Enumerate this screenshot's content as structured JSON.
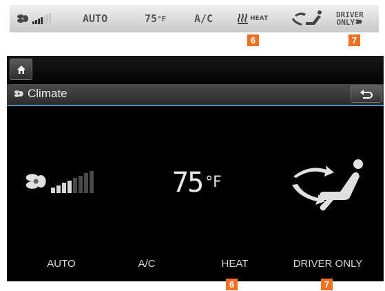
{
  "status_strip": {
    "fan_bars": {
      "level": 4,
      "max": 7
    },
    "auto": "AUTO",
    "temperature": "75",
    "temperature_unit": "°F",
    "ac": "A/C",
    "heat": "HEAT",
    "driver_only_line1": "DRIVER",
    "driver_only_line2": "ONLY"
  },
  "callouts": {
    "heat": "6",
    "driver_only": "7"
  },
  "screen": {
    "title": "Climate",
    "fan_level": {
      "level": 4,
      "max": 8
    },
    "temperature": "75",
    "temperature_unit": "°F",
    "buttons": {
      "auto": "AUTO",
      "ac": "A/C",
      "heat": "HEAT",
      "driver_only": "DRIVER ONLY"
    }
  },
  "icons": [
    "fan-icon",
    "heat-waves-icon",
    "seat-airflow-icon",
    "home-icon",
    "back-icon"
  ],
  "colors": {
    "accent_line": "#4a90c8",
    "callout": "#f26e21",
    "screen_bg": "#000000"
  }
}
